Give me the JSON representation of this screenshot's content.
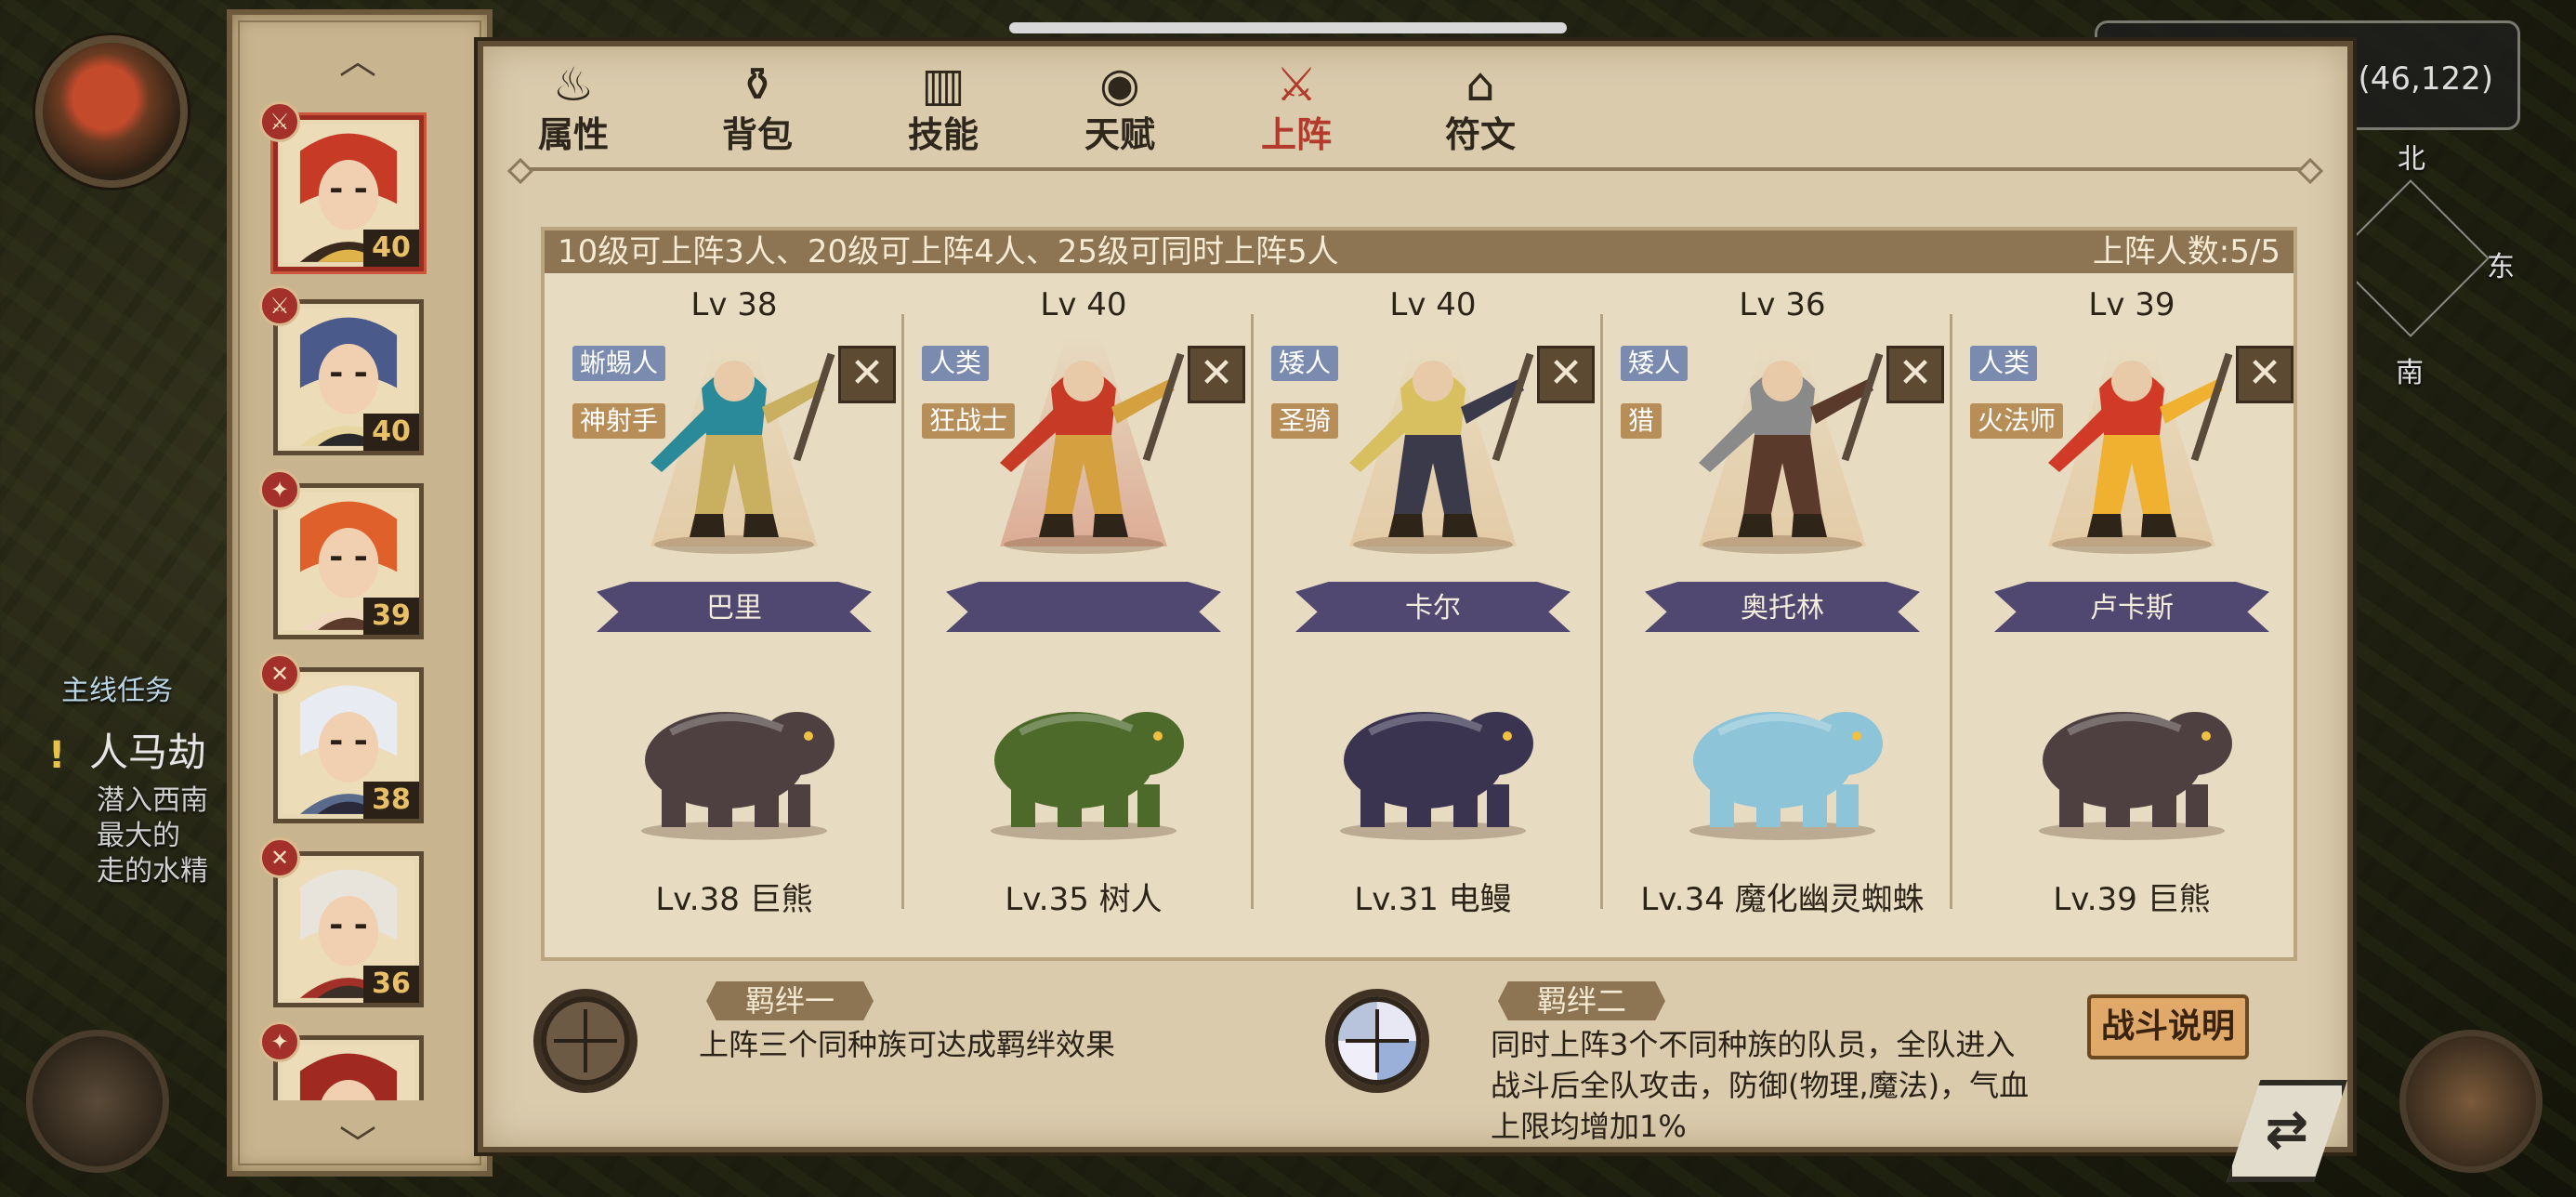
{
  "hud": {
    "coordinates": "(46,122)",
    "compass": {
      "north": "北",
      "east": "东",
      "south": "南"
    },
    "quest": {
      "section": "主线任务",
      "title": "人马劫",
      "lines": [
        "潜入西南",
        "最大的",
        "走的水精"
      ]
    }
  },
  "heroes": [
    {
      "name": "red-haired-warrior",
      "level": "40",
      "badge": "⚔",
      "colors": [
        "#c73a26",
        "#3a2a1e",
        "#e0b24a"
      ]
    },
    {
      "name": "armored-knight",
      "level": "40",
      "badge": "⚔",
      "colors": [
        "#4a5a8a",
        "#e8d6a0",
        "#2a2a2a"
      ]
    },
    {
      "name": "orange-haired-mage",
      "level": "39",
      "badge": "✦",
      "colors": [
        "#e0602c",
        "#f0d8c0",
        "#5a3a2a"
      ]
    },
    {
      "name": "white-wolf-beast",
      "level": "38",
      "badge": "✕",
      "colors": [
        "#e8ecf2",
        "#5a6a8a",
        "#2a2a3a"
      ]
    },
    {
      "name": "white-dwarf",
      "level": "36",
      "badge": "✕",
      "colors": [
        "#e8e4dc",
        "#a03028",
        "#3a3028"
      ]
    },
    {
      "name": "red-hat-figure",
      "level": "",
      "badge": "✦",
      "colors": [
        "#a02a22",
        "#e8d8c8",
        "#3a2a22"
      ]
    }
  ],
  "tabs": [
    {
      "label": "属性",
      "icon": "flame-icon",
      "glyph": "♨"
    },
    {
      "label": "背包",
      "icon": "bag-icon",
      "glyph": "⚱"
    },
    {
      "label": "技能",
      "icon": "book-icon",
      "glyph": "▥"
    },
    {
      "label": "天赋",
      "icon": "eye-icon",
      "glyph": "◉"
    },
    {
      "label": "上阵",
      "icon": "crossed-swords-icon",
      "glyph": "⚔",
      "active": true
    },
    {
      "label": "符文",
      "icon": "rune-icon",
      "glyph": "⌂"
    }
  ],
  "lineup": {
    "rule_text": "10级可上阵3人、20级可上阵4人、25级可同时上阵5人",
    "count_label": "上阵人数:5/5",
    "slots": [
      {
        "level": "Lv 38",
        "race": "蜥蜴人",
        "class": "神射手",
        "name": "巴里",
        "pet": "Lv.38 巨熊",
        "hero_color": "#2a8a9a",
        "accent": "#c8b060",
        "pet_color": "#4e4040",
        "cone": "tan"
      },
      {
        "level": "Lv 40",
        "race": "人类",
        "class": "狂战士",
        "name": "",
        "pet": "Lv.35 树人",
        "hero_color": "#c73a26",
        "accent": "#d4a040",
        "pet_color": "#4e6a2a",
        "cone": "red"
      },
      {
        "level": "Lv 40",
        "race": "矮人",
        "class": "圣骑",
        "name": "卡尔",
        "pet": "Lv.31 电鳗",
        "hero_color": "#d8c060",
        "accent": "#3a3a4a",
        "pet_color": "#3a3450",
        "cone": "tan"
      },
      {
        "level": "Lv 36",
        "race": "矮人",
        "class": "猎",
        "name": "奥托林",
        "pet": "Lv.34 魔化幽灵蜘蛛",
        "hero_color": "#8a8a8a",
        "accent": "#5a3a2a",
        "pet_color": "#8ec4d8",
        "cone": "tan"
      },
      {
        "level": "Lv 39",
        "race": "人类",
        "class": "火法师",
        "name": "卢卡斯",
        "pet": "Lv.39 巨熊",
        "hero_color": "#d03a26",
        "accent": "#f0b030",
        "pet_color": "#4e4040",
        "cone": "tan"
      }
    ]
  },
  "bonds": [
    {
      "title": "羁绊一",
      "description": [
        "上阵三个同种族可达成羁绊效果"
      ],
      "active": false
    },
    {
      "title": "羁绊二",
      "description": [
        "同时上阵3个不同种族的队员，全队进入",
        "战斗后全队攻击，防御(物理,魔法)，气血",
        "上限均增加1%"
      ],
      "active": true
    }
  ],
  "battle_help_label": "战斗说明",
  "swap_glyph": "⇄",
  "remove_glyph": "✕"
}
